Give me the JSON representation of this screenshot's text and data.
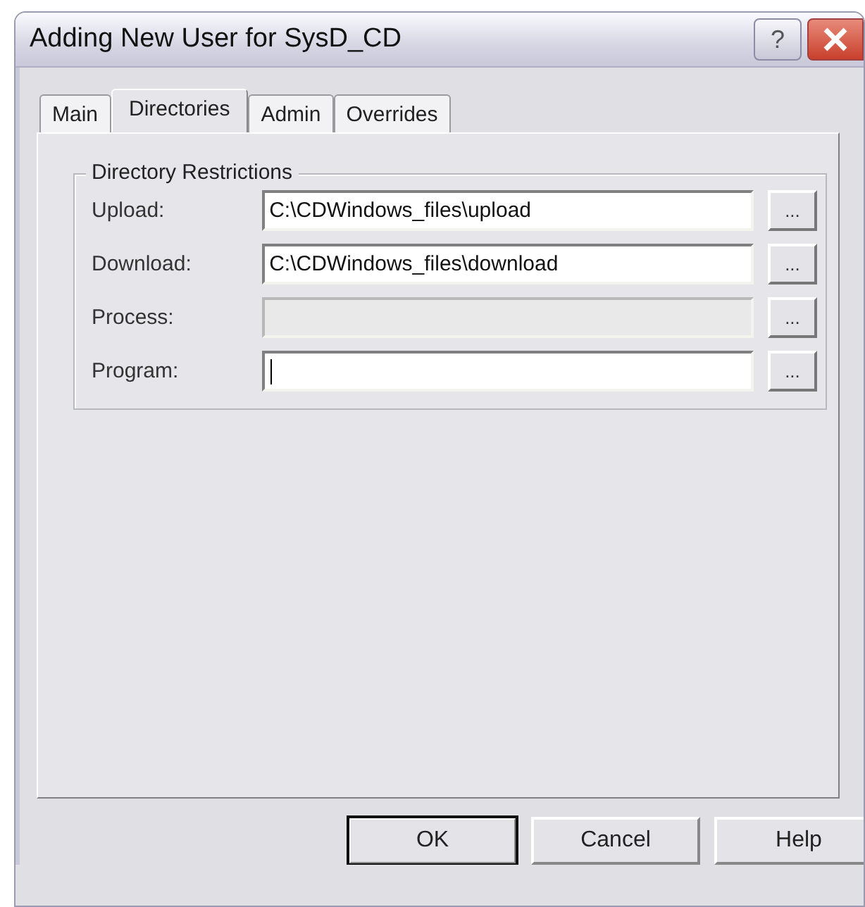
{
  "window": {
    "title": "Adding New User for SysD_CD",
    "help_button": "?"
  },
  "tabs": [
    {
      "label": "Main",
      "selected": false
    },
    {
      "label": "Directories",
      "selected": true
    },
    {
      "label": "Admin",
      "selected": false
    },
    {
      "label": "Overrides",
      "selected": false
    }
  ],
  "group": {
    "title": "Directory Restrictions",
    "rows": [
      {
        "label": "Upload:",
        "value": "C:\\CDWindows_files\\upload",
        "disabled": false,
        "focused": false,
        "browse": "..."
      },
      {
        "label": "Download:",
        "value": "C:\\CDWindows_files\\download",
        "disabled": false,
        "focused": false,
        "browse": "..."
      },
      {
        "label": "Process:",
        "disabled": true,
        "focused": false,
        "browse": "..."
      },
      {
        "label": "Program:",
        "disabled": false,
        "focused": true,
        "browse": "..."
      }
    ]
  },
  "buttons": [
    {
      "label": "OK",
      "default": true
    },
    {
      "label": "Cancel",
      "default": false
    },
    {
      "label": "Help",
      "default": false
    }
  ]
}
